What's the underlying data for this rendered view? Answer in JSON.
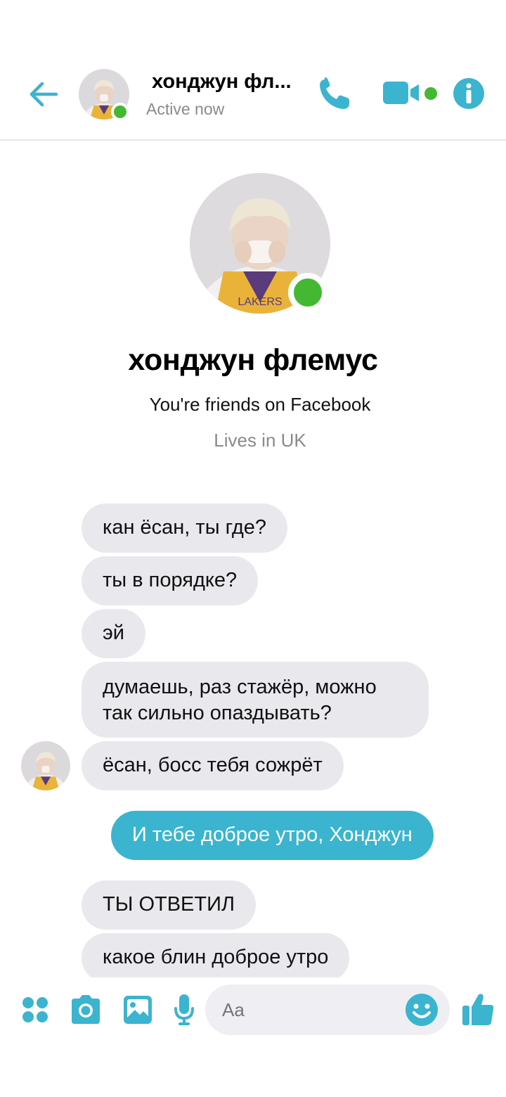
{
  "colors": {
    "accent": "#3bb4cf",
    "online": "#44b833",
    "incoming_bubble": "#e9e8ec"
  },
  "header": {
    "back_icon": "back-arrow-icon",
    "contact_name": "хонджун фл...",
    "status": "Active now",
    "call_icon": "phone-icon",
    "video_icon": "video-camera-icon",
    "info_icon": "info-icon"
  },
  "profile": {
    "name": "хонджун флемус",
    "friends": "You're friends on Facebook",
    "lives": "Lives in UK"
  },
  "messages": [
    {
      "from": "them",
      "text": "кан ёсан, ты где?"
    },
    {
      "from": "them",
      "text": "ты в порядке?"
    },
    {
      "from": "them",
      "text": "эй"
    },
    {
      "from": "them",
      "text": "думаешь, раз стажёр, можно так сильно опаздывать?"
    },
    {
      "from": "them",
      "text": "ёсан, босс тебя сожрёт"
    },
    {
      "from": "me",
      "text": "И тебе доброе утро, Хонджун"
    },
    {
      "from": "them",
      "text": "ТЫ ОТВЕТИЛ"
    },
    {
      "from": "them",
      "text": "какое блин доброе утро"
    }
  ],
  "composer": {
    "placeholder": "Aa",
    "icons": [
      "apps-icon",
      "camera-icon",
      "image-icon",
      "microphone-icon",
      "emoji-icon",
      "thumbs-up-icon"
    ]
  }
}
